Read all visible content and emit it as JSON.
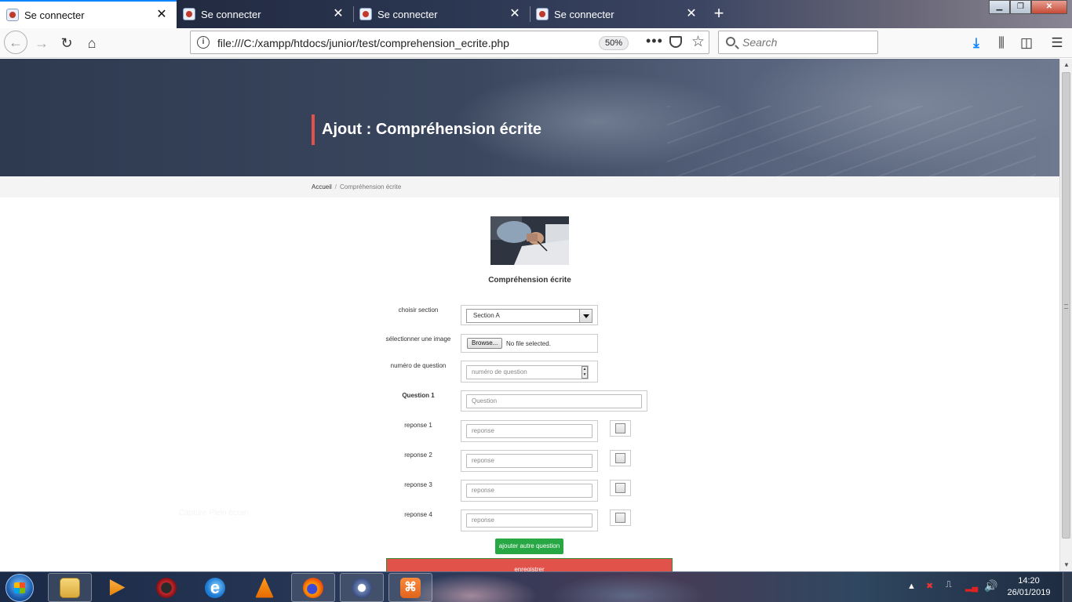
{
  "browser": {
    "tabs": [
      {
        "title": "Se connecter",
        "active": true
      },
      {
        "title": "Se connecter",
        "active": false
      },
      {
        "title": "Se connecter",
        "active": false
      },
      {
        "title": "Se connecter",
        "active": false
      }
    ],
    "url": "file:///C:/xampp/htdocs/junior/test/comprehension_ecrite.php",
    "zoom": "50%",
    "search_placeholder": "Search"
  },
  "page": {
    "hero_title": "Ajout : Compréhension écrite",
    "breadcrumb": {
      "home": "Accueil",
      "separator": "/",
      "current": "Compréhension écrite"
    },
    "section_title": "Compréhension écrite",
    "form": {
      "section_label": "choisir section",
      "section_value": "Section A",
      "image_label": "sélectionner une image",
      "browse_label": "Browse...",
      "no_file": "No file selected.",
      "number_label": "numéro de question",
      "number_placeholder": "numéro de question",
      "question_label": "Question 1",
      "question_placeholder": "Question",
      "answers": [
        {
          "label": "reponse 1",
          "placeholder": "reponse"
        },
        {
          "label": "reponse 2",
          "placeholder": "reponse"
        },
        {
          "label": "reponse 3",
          "placeholder": "reponse"
        },
        {
          "label": "reponse 4",
          "placeholder": "reponse"
        }
      ],
      "add_button": "ajouter autre question",
      "save_button": "enregistrer"
    },
    "ghost_text": "Capture Plein écran"
  },
  "taskbar": {
    "time": "14:20",
    "date": "26/01/2019",
    "apps": [
      "explorer-icon",
      "media-player-icon",
      "opera-icon",
      "internet-explorer-icon",
      "vlc-icon",
      "firefox-icon",
      "bittorrent-icon",
      "xampp-icon"
    ]
  }
}
